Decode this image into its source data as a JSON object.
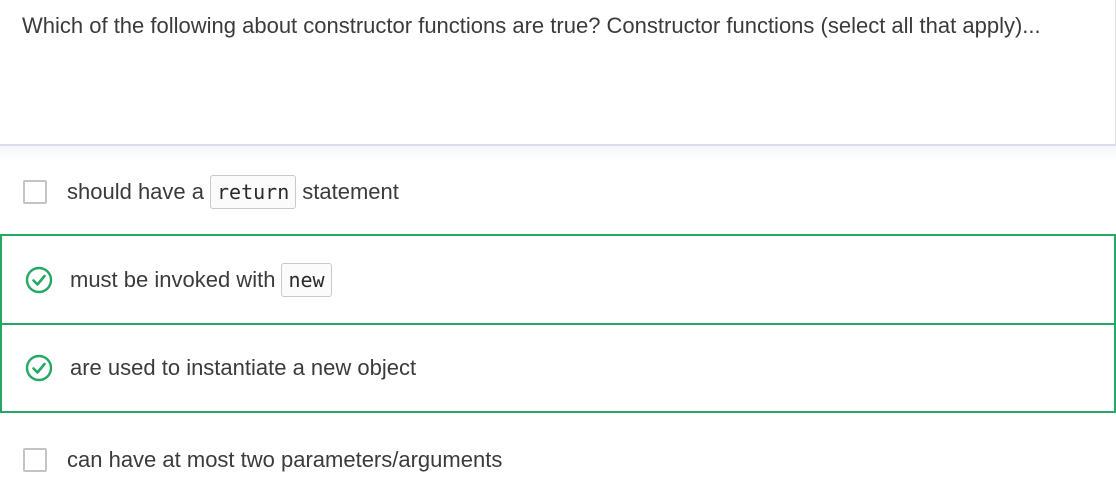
{
  "question": {
    "text": "Which of the following about constructor functions are true? Constructor functions (select all that apply)..."
  },
  "options": [
    {
      "state": "unchecked",
      "text_before": "should have a",
      "code": "return",
      "text_after": "statement"
    },
    {
      "state": "correct",
      "text_before": "must be invoked with",
      "code": "new",
      "text_after": ""
    },
    {
      "state": "correct",
      "text_before": "are used to instantiate a new object",
      "code": "",
      "text_after": ""
    },
    {
      "state": "unchecked",
      "text_before": "can have at most two parameters/arguments",
      "code": "",
      "text_after": ""
    }
  ],
  "colors": {
    "correct": "#25a863",
    "checkbox_border": "#c4c4c4",
    "text": "#3b3b3b"
  },
  "icons": {
    "correct": "check-circle-icon",
    "unchecked": "checkbox-icon"
  }
}
